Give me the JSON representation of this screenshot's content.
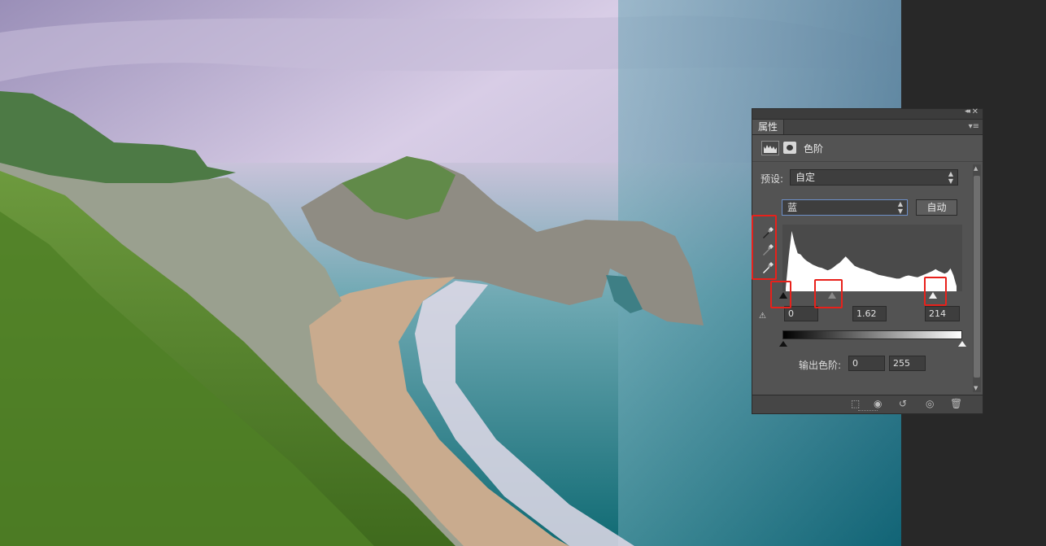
{
  "panel": {
    "tab_label": "属性",
    "adjustment_title": "色阶",
    "preset_label": "预设:",
    "preset_value": "自定",
    "channel_value": "蓝",
    "auto_button": "自动",
    "input_levels": {
      "black": "0",
      "gamma": "1.62",
      "white": "214"
    },
    "output_label": "输出色阶:",
    "output_levels": {
      "black": "0",
      "white": "255"
    },
    "icons": [
      "levels-histogram-icon",
      "mask-icon",
      "eyedropper-black-icon",
      "eyedropper-gray-icon",
      "eyedropper-white-icon",
      "clipping-warning-icon",
      "clip-to-layer-icon",
      "view-previous-icon",
      "reset-icon",
      "visibility-icon",
      "trash-icon",
      "panel-menu-icon",
      "collapse-icon",
      "close-icon"
    ]
  },
  "histogram_heights": [
    0.05,
    0.55,
    0.95,
    0.75,
    0.6,
    0.58,
    0.52,
    0.48,
    0.45,
    0.42,
    0.4,
    0.38,
    0.37,
    0.35,
    0.33,
    0.35,
    0.38,
    0.42,
    0.45,
    0.5,
    0.55,
    0.5,
    0.45,
    0.4,
    0.38,
    0.36,
    0.35,
    0.33,
    0.32,
    0.3,
    0.28,
    0.26,
    0.25,
    0.24,
    0.23,
    0.22,
    0.21,
    0.2,
    0.2,
    0.22,
    0.24,
    0.25,
    0.24,
    0.23,
    0.22,
    0.24,
    0.26,
    0.28,
    0.3,
    0.32,
    0.35,
    0.32,
    0.3,
    0.28,
    0.3,
    0.36,
    0.25,
    0.08
  ]
}
